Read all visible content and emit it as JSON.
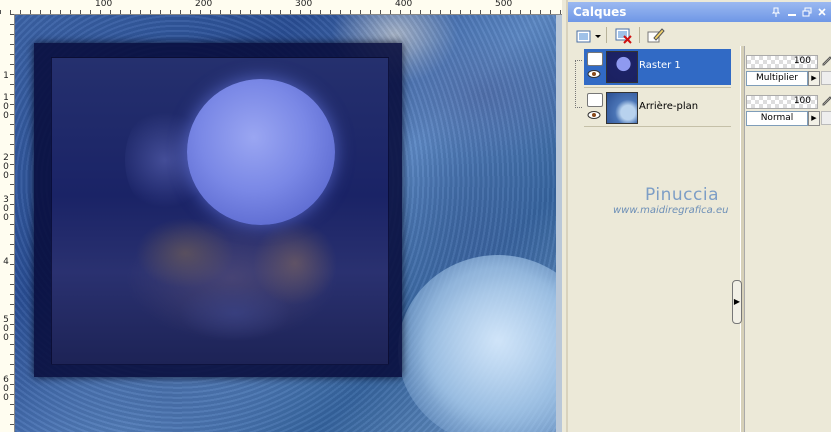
{
  "rulers": {
    "top": [
      "100",
      "200",
      "300",
      "400",
      "500"
    ],
    "left": [
      "1",
      "100",
      "200",
      "300",
      "4",
      "500",
      "600"
    ]
  },
  "palette": {
    "title": "Calques",
    "title_buttons": [
      "pin-icon",
      "minimize-icon",
      "restore-icon",
      "close-icon"
    ],
    "toolbar": [
      "new-layer-icon",
      "dropdown-arrow-icon",
      "delete-layer-icon",
      "edit-layer-icon"
    ]
  },
  "layers": [
    {
      "name": "Raster 1",
      "selected": true,
      "opacity": "100",
      "blend": "Multiplier"
    },
    {
      "name": "Arrière-plan",
      "selected": false,
      "opacity": "100",
      "blend": "Normal"
    }
  ],
  "watermark": {
    "name": "Pinuccia",
    "url": "www.maidiregrafica.eu"
  },
  "colors": {
    "selection": "#316ac5",
    "title_bar": "#6f97e6",
    "panel_bg": "#ece9d8"
  }
}
